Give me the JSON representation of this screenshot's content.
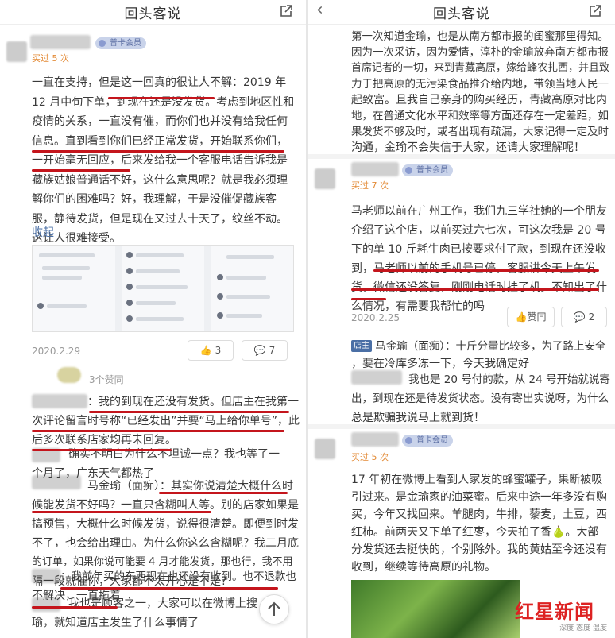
{
  "colors": {
    "accent_underline": "#c4151c",
    "vip_bg": "#c9d3ea",
    "purchase_count": "#e38b37",
    "link": "#4a6fa5",
    "watermark_red": "#d22"
  },
  "left": {
    "title": "回头客说",
    "review1": {
      "vip": "普卡会员",
      "bought": "买过 5 次",
      "lines": [
        "一直在支持，但是这一回真的很让人不解：2019 年",
        "12 月中旬下单，到现在还是没发货。考虑到地区性和",
        "疫情的关系，一直没有催，而你们也并没有给我任何",
        "信息。直到看到你们已经正常发货，开始联系你们，",
        "一开始毫无回应，后来发给我一个客服电话告诉我是",
        "藏族姑娘普通话不好，这什么意思呢？就是我必须理",
        "解你们的困难吗？好，我理解，于是没催促藏族客",
        "服，静待发货，但是现在又过去十天了，纹丝不动。",
        "这让人很难接受。"
      ],
      "collapse": "收起",
      "date": "2020.2.29",
      "likes": "3",
      "comments": "7"
    },
    "replies_header": "3个赞同",
    "replies": [
      "：我的到现在还没有发货。但店主在我第一",
      "次评论留言时号称“已经发出”并要“马上给你单号”，此",
      "后多次联系店家均再未回复。",
      "确实不明白为什么不坦诚一点？我也等了一",
      "个月了，广东天气都热了",
      "马金瑜（面痴）：其实你说清楚大概什么时",
      "候能发货不好吗？一直只含糊叫人等。别的店家如果是",
      "搞预售，大概什么时候发货，说得很清楚。即便到时发",
      "不了，也会给出理由。为什么你这么含糊呢？我二月底",
      "的订单，如果你说可能要 4 月才能发货，那也行，我不用",
      "隔一段就催你，大家都不太开心是不是?",
      "：我前年买的东西现在也还没有收到。也不退款也",
      "不解决，一直拖着",
      "我也是顾客之一，大家可以在微博上搜",
      "瑜，就知道店主发生了什么事情了"
    ]
  },
  "right": {
    "title": "回头客说",
    "top_lines": [
      "第一次知道金瑜，也是从南方都市报的闺蜜那里得知。",
      "因为一次采访，因为爱情，淳朴的金瑜放弃南方都市报",
      "首席记者的一切，来到青藏高原，嫁给蜂农扎西，并且致",
      "力于把高原的无污染食品推介给内地，带领当地人民一",
      "起致富。且我自己亲身的购买经历，青藏高原对比内",
      "地，在普通文化水平和效率等方面还存在一定差距，如",
      "果发货不够及时，或者出现有疏漏，大家记得一定及时",
      "沟通，金瑜不会失信于大家，还请大家理解呢！"
    ],
    "review2": {
      "vip": "普卡会员",
      "bought": "买过 7 次",
      "lines": [
        "马老师以前在广州工作，我们九三学社她的一个朋友",
        "介绍了这个店，以前买过六七次，可这次我是 20 号",
        "下的单 10 斤耗牛肉已按要求付了款，到现在还没收",
        "到，马老师以前的手机号已停，客服讲今天上午发",
        "货，微信还没答复，刚刚电话时挂了机。不知出了什",
        "么情况，有需要我帮忙的吗"
      ],
      "date": "2020.2.25",
      "likes": "赞同",
      "comments": "2"
    },
    "owner_reply": {
      "badge": "店主",
      "lines": [
        "马金瑜（面痴）：十斤分量比较多，为了路上安全",
        "，要在冷库多冻一下，今天我确定好",
        "我也是 20 号付的款，从 24 号开始就说寄",
        "出，到现在还是待发货状态。没有寄出实说呀，为什么",
        "总是欺骗我说马上就到货！"
      ]
    },
    "review3": {
      "vip": "普卡会员",
      "bought": "买过 5 次",
      "lines": [
        "17 年初在微博上看到人家发的蜂蜜罐子，果断被吸",
        "引过来。是金瑜家的油菜蜜。后来中途一年多没有购",
        "买，今年又找回来。羊腿肉，牛排，藜麦，土豆，西",
        "红柿。前两天又下单了红枣，今天拍了香🍐。大部",
        "分发货还去挺快的，个别除外。我的黄姑至今还没有",
        "收到，继续等待高原的礼物。"
      ]
    },
    "watermark": {
      "main": "红星新闻",
      "sub": "深度 态度 温度"
    }
  }
}
